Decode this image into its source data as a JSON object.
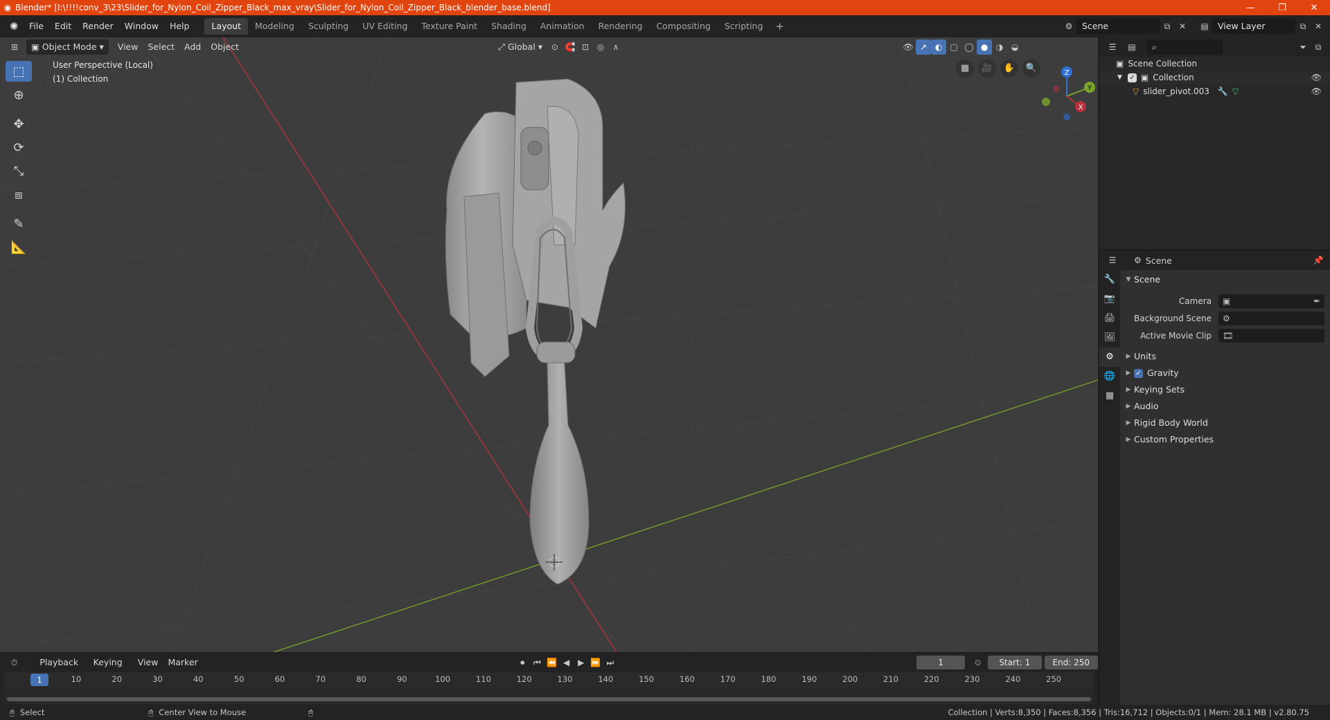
{
  "window": {
    "title": "Blender* [I:\\!!!!conv_3\\23\\Slider_for_Nylon_Coil_Zipper_Black_max_vray\\Slider_for_Nylon_Coil_Zipper_Black_blender_base.blend]",
    "minimize": "—",
    "maximize": "❐",
    "close": "✕"
  },
  "menu": {
    "items": [
      "File",
      "Edit",
      "Render",
      "Window",
      "Help"
    ]
  },
  "workspaces": {
    "tabs": [
      "Layout",
      "Modeling",
      "Sculpting",
      "UV Editing",
      "Texture Paint",
      "Shading",
      "Animation",
      "Rendering",
      "Compositing",
      "Scripting"
    ],
    "active": "Layout",
    "add": "+"
  },
  "scene_selector": {
    "value": "Scene"
  },
  "view_layer_selector": {
    "value": "View Layer"
  },
  "viewport": {
    "mode": "Object Mode",
    "menus": [
      "View",
      "Select",
      "Add",
      "Object"
    ],
    "orientation": "Global",
    "info_line1": "User Perspective (Local)",
    "info_line2": "(1) Collection",
    "axes": {
      "x": "X",
      "y": "Y",
      "z": "Z"
    }
  },
  "outliner": {
    "root": "Scene Collection",
    "collection": "Collection",
    "object": "slider_pivot.003"
  },
  "properties": {
    "context": "Scene",
    "panel": "Scene",
    "fields": [
      {
        "label": "Camera",
        "value": ""
      },
      {
        "label": "Background Scene",
        "value": ""
      },
      {
        "label": "Active Movie Clip",
        "value": ""
      }
    ],
    "subpanels": [
      "Units",
      "Gravity",
      "Keying Sets",
      "Audio",
      "Rigid Body World",
      "Custom Properties"
    ],
    "gravity_checked": true
  },
  "timeline": {
    "menus": [
      "Playback",
      "Keying",
      "View",
      "Marker"
    ],
    "current_frame": "1",
    "start_label": "Start:",
    "start": "1",
    "end_label": "End:",
    "end": "250",
    "ruler": [
      "1",
      "10",
      "20",
      "30",
      "40",
      "50",
      "60",
      "70",
      "80",
      "90",
      "100",
      "110",
      "120",
      "130",
      "140",
      "150",
      "160",
      "170",
      "180",
      "190",
      "200",
      "210",
      "220",
      "230",
      "240",
      "250"
    ]
  },
  "statusbar": {
    "left_action": "Select",
    "middle_action": "Center View to Mouse",
    "stats": "Collection | Verts:8,350 | Faces:8,356 | Tris:16,712 | Objects:0/1 | Mem: 28.1 MB | v2.80.75"
  },
  "colors": {
    "titlebar": "#e2440f",
    "accent": "#4772b3",
    "viewport_bg": "#3d3d3d",
    "x_axis": "#b8323d",
    "y_axis": "#7aa52a",
    "z_axis": "#2f72d8",
    "model": "#9b9b9b"
  }
}
